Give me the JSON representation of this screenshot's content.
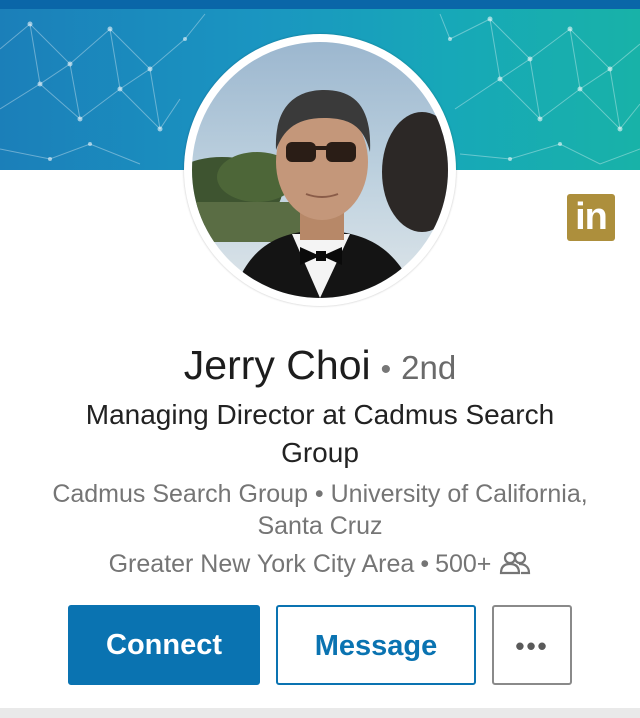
{
  "profile": {
    "name": "Jerry Choi",
    "separator": "•",
    "degree": "2nd",
    "headline": "Managing Director at Cadmus Search Group",
    "company_education": "Cadmus Search Group • University of California, Santa Cruz",
    "location": "Greater New York City Area",
    "location_separator": "•",
    "connections": "500+",
    "connections_icon": "people-icon"
  },
  "badge": {
    "label": "in",
    "icon": "linkedin-icon",
    "color": "#ad8f3c"
  },
  "actions": {
    "connect_label": "Connect",
    "message_label": "Message",
    "more_label": "•••",
    "more_icon": "more-options-icon"
  },
  "colors": {
    "primary": "#0a73b1",
    "banner_start": "#1b7fb9",
    "banner_end": "#18b2a8"
  }
}
